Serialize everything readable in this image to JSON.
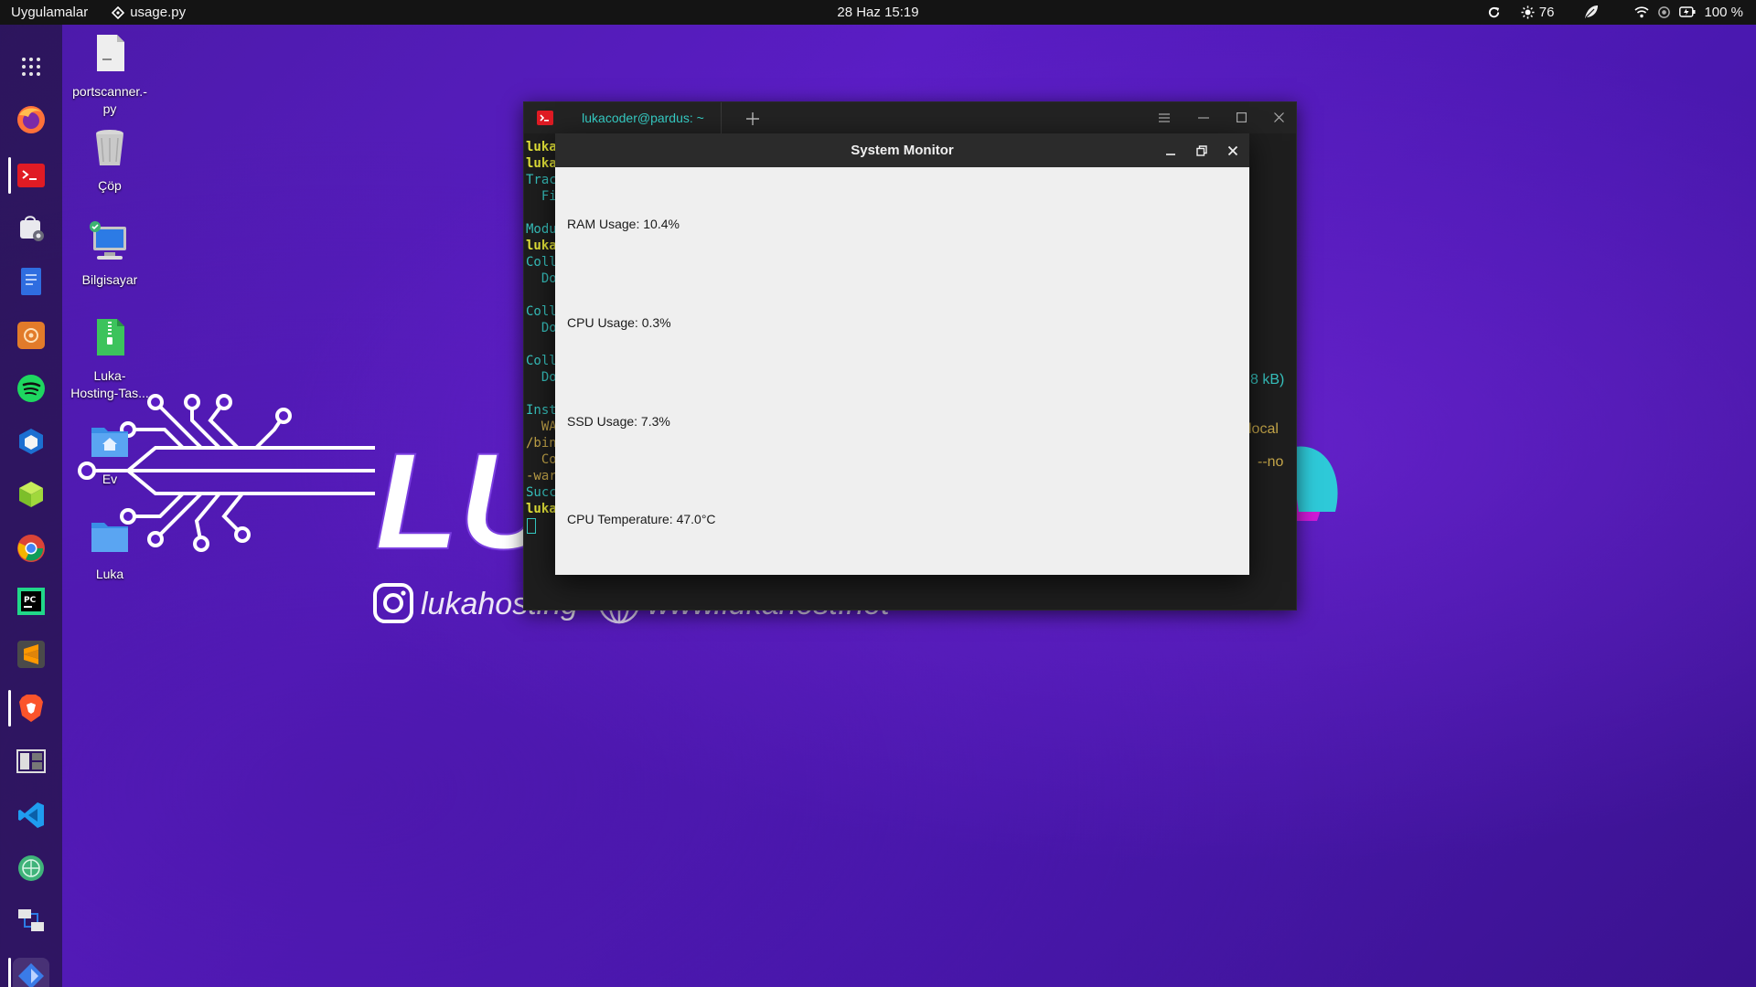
{
  "topbar": {
    "apps_label": "Uygulamalar",
    "active_app": "usage.py",
    "datetime": "28 Haz  15:19",
    "brightness": "76",
    "battery": "100 %"
  },
  "dock": {
    "items": [
      "app-grid",
      "firefox",
      "terminal",
      "software-center",
      "text-editor",
      "network-tool",
      "spotify",
      "virtualbox",
      "3d-cube-app",
      "chrome",
      "pycharm",
      "sublime-text",
      "brave",
      "workspace-switcher",
      "vscode",
      "world-app",
      "network-manager",
      "sysmon-python"
    ]
  },
  "desktop": {
    "icons": [
      {
        "label": "portscanner.-\npy"
      },
      {
        "label": "Çöp"
      },
      {
        "label": "Bilgisayar"
      },
      {
        "label": "Luka-\nHosting-Tas..."
      },
      {
        "label": "Ev"
      },
      {
        "label": "Luka"
      }
    ],
    "wallpaper": {
      "brand": "LU",
      "instagram": "lukahosting",
      "website": "www.lukahost.net"
    }
  },
  "terminal": {
    "tab_title": "lukacoder@pardus: ~",
    "lines": [
      {
        "text": "luka",
        "color": "#e8e83a",
        "bold": true
      },
      {
        "text": "luka",
        "color": "#e8e83a",
        "bold": true
      },
      {
        "text": "Trac",
        "color": "#37c4c0"
      },
      {
        "text": "  Fi",
        "color": "#37c4c0"
      },
      {
        "text": "",
        "color": "#37c4c0"
      },
      {
        "text": "Modu",
        "color": "#37c4c0"
      },
      {
        "text": "luka",
        "color": "#e8e83a",
        "bold": true
      },
      {
        "text": "Coll",
        "color": "#37c4c0"
      },
      {
        "text": "  Do",
        "color": "#37c4c0"
      },
      {
        "text": "",
        "color": "#37c4c0"
      },
      {
        "text": "Coll",
        "color": "#37c4c0"
      },
      {
        "text": "  Do",
        "color": "#37c4c0"
      },
      {
        "text": "",
        "color": "#37c4c0"
      },
      {
        "text": "Coll",
        "color": "#37c4c0"
      },
      {
        "text": "  Do",
        "color": "#37c4c0"
      },
      {
        "text": "",
        "color": "#37c4c0"
      },
      {
        "text": "Inst",
        "color": "#37c4c0"
      },
      {
        "text": "  WA",
        "color": "#c7a84a"
      },
      {
        "text": "/bin",
        "color": "#c7a84a"
      },
      {
        "text": "  Co",
        "color": "#c7a84a"
      },
      {
        "text": "-war",
        "color": "#c7a84a"
      },
      {
        "text": "Succ",
        "color": "#37c4c0"
      },
      {
        "text": "luka",
        "color": "#e8e83a",
        "bold": true
      }
    ],
    "right_fragments": [
      {
        "text": "8 kB)",
        "color": "#37c4c0"
      },
      {
        "text": "local",
        "color": "#c7a84a"
      },
      {
        "text": "--no",
        "color": "#c7a84a"
      }
    ]
  },
  "system_monitor": {
    "title": "System Monitor",
    "ram": "RAM Usage: 10.4%",
    "cpu": "CPU Usage: 0.3%",
    "ssd": "SSD Usage: 7.3%",
    "temp": "CPU Temperature: 47.0°C"
  }
}
